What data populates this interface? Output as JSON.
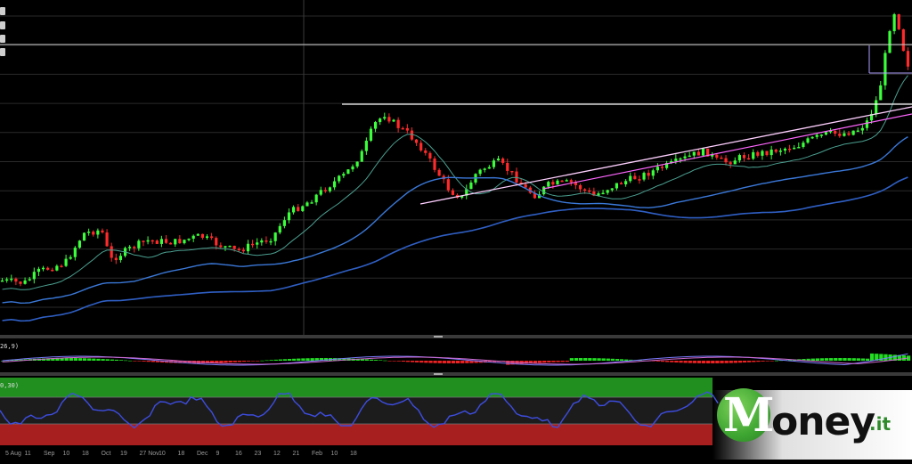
{
  "chart_data": [
    {
      "type": "candlestick",
      "panel": "price",
      "series": [
        {
          "name": "",
          "color": "#3cff3c",
          "role": "up-candle"
        },
        {
          "name": "",
          "color": "#ff2a2a",
          "role": "down-candle"
        },
        {
          "name": "",
          "color": "#4a9f8f",
          "role": "short-moving-average"
        },
        {
          "name": "",
          "color": "#3a78d8",
          "role": "medium-moving-average"
        },
        {
          "name": "",
          "color": "#2f5fc4",
          "role": "long-moving-average"
        }
      ],
      "trendlines": [
        {
          "color": "#ffffff",
          "kind": "horizontal-resistance"
        },
        {
          "color": "#ffffff",
          "kind": "horizontal-top"
        },
        {
          "color": "#ff66ff",
          "kind": "rising-channel"
        },
        {
          "color": "#ffffff",
          "kind": "rising-trendline"
        }
      ],
      "grid": true
    },
    {
      "type": "histogram",
      "panel": "macd",
      "label": "26,9)",
      "colors": {
        "positive": "#22dd22",
        "negative": "#ee2222",
        "signal": "#d06ad0",
        "line": "#7b7bff"
      }
    },
    {
      "type": "line",
      "panel": "oscillator",
      "label": "0,30)",
      "colors": {
        "line": "#3d4de0",
        "overbought_zone": "#26a826",
        "oversold_zone": "#c42424"
      }
    }
  ],
  "xaxis": {
    "ticks": [
      "5 Aug",
      "11",
      "Sep",
      "10",
      "18",
      "Oct",
      "19",
      "27 Nov",
      "10",
      "18",
      "Dec",
      "9",
      "16",
      "23",
      "12",
      "21",
      "Feb",
      "10",
      "18"
    ]
  },
  "logo": {
    "text": "Money.it",
    "colors": {
      "green": "#3da531",
      "dark": "#111111"
    }
  }
}
